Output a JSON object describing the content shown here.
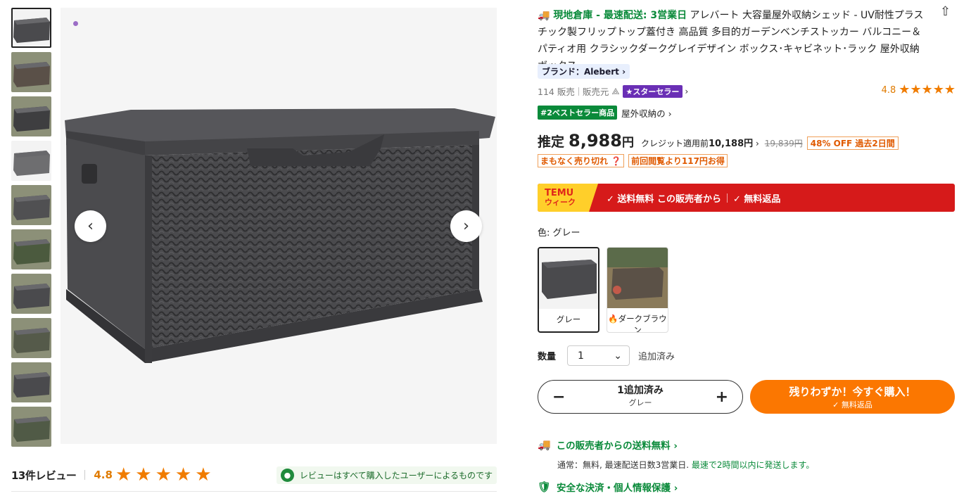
{
  "gallery": {
    "thumbnail_count": 10,
    "prev_icon": "‹",
    "next_icon": "›"
  },
  "reviews": {
    "count_label": "13件レビュー",
    "score": "4.8",
    "stars": 4.8,
    "note": "レビューはすべて購入したユーザーによるものです"
  },
  "product": {
    "title_prefix": "現地倉庫 - 最速配送: 3営業日",
    "title": "アレバート 大容量屋外収納シェッド - UV耐性プラスチック製フリップトップ蓋付き 高品質 多目的ガーデンベンチストッカー バルコニー＆パティオ用 クラシックダークグレイデザイン ボックス･キャビネット･ラック 屋外収納ボックス",
    "brand": "ブランド：Alebert ›",
    "sold": "114 販売",
    "seller_label": "販売元",
    "seller_icon": "⟁",
    "star_seller": "★スターセラー",
    "rating": "4.8",
    "bestseller_tag": "#2ベストセラー商品",
    "bestseller_category": "屋外収納の ›"
  },
  "price": {
    "label": "推定",
    "amount": "8,988",
    "yen": "円",
    "credit_prefix": "クレジット適用前",
    "credit_amount": "10,188円",
    "original": "19,839円",
    "discount": "48% OFF 過去2日間",
    "chip_soldout": "まもなく売り切れ ❓",
    "chip_saving": "前回閲覧より117円お得"
  },
  "banner": {
    "line1": "TEMU",
    "line2": "ウィーク",
    "free_shipping": "✓ 送料無料 この販売者から",
    "free_return": "✓ 無料返品"
  },
  "colors": {
    "label": "色: グレー",
    "options": [
      "グレー",
      "ダークブラウン"
    ]
  },
  "quantity": {
    "label": "数量",
    "value": "1",
    "added": "追加済み"
  },
  "cart": {
    "added_text": "1追加済み",
    "variant": "グレー",
    "minus": "−",
    "plus": "+"
  },
  "buy": {
    "label": "残りわずか！今すぐ購入！",
    "sub": "✓ 無料返品"
  },
  "shipping": {
    "title": "この販売者からの送料無料 ›",
    "detail_a": "通常：無料, 最速配送日数3営業日. ",
    "detail_b": "最速で2時間以内に発送します。",
    "secure": "安全な決済・個人情報保護 ›"
  },
  "accent_colors": {
    "orange": "#fb7701",
    "green": "#0a8a3a",
    "red": "#d61a1a"
  }
}
